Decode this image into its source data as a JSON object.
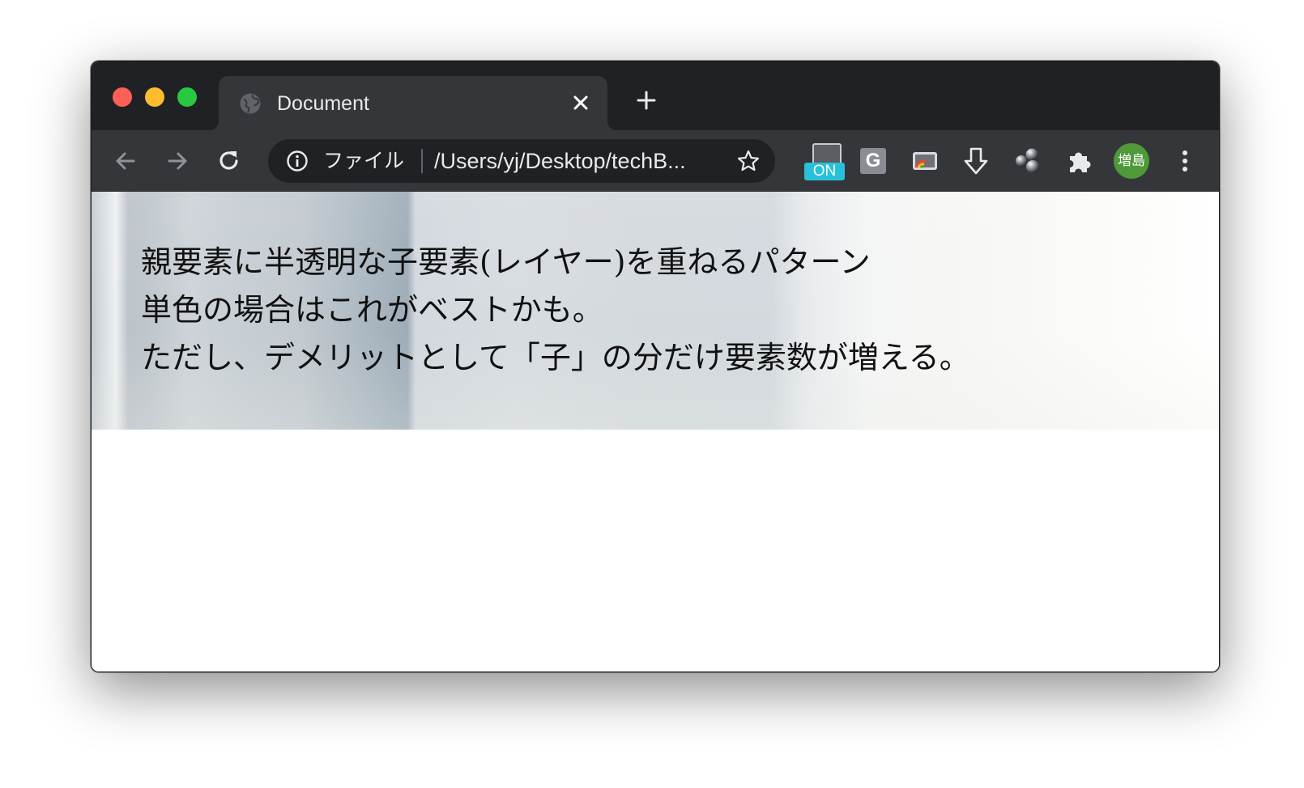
{
  "tab": {
    "title": "Document"
  },
  "omnibox": {
    "scheme_label": "ファイル",
    "url": "/Users/yj/Desktop/techB..."
  },
  "extensions": {
    "on_badge": "ON",
    "g_label": "G"
  },
  "profile": {
    "avatar_label": "増島",
    "avatar_color": "#4e9a3a"
  },
  "page": {
    "lines": [
      "親要素に半透明な子要素(レイヤー)を重ねるパターン",
      "単色の場合はこれがベストかも。",
      "ただし、デメリットとして「子」の分だけ要素数が増える。"
    ]
  },
  "colors": {
    "titlebar": "#202124",
    "toolbar": "#35363a",
    "omnibox": "#202124",
    "on_badge": "#27c1d9"
  },
  "icons": {
    "tab_favicon": "globe-icon",
    "tab_close": "close-icon",
    "new_tab": "plus-icon",
    "back": "arrow-left-icon",
    "forward": "arrow-right-icon",
    "reload": "reload-icon",
    "info": "info-icon",
    "bookmark": "star-icon",
    "extension_cast": "cast-icon",
    "extension_download": "download-icon",
    "extension_balls": "molecule-icon",
    "extensions_menu": "puzzle-icon",
    "menu": "more-vertical-icon"
  }
}
